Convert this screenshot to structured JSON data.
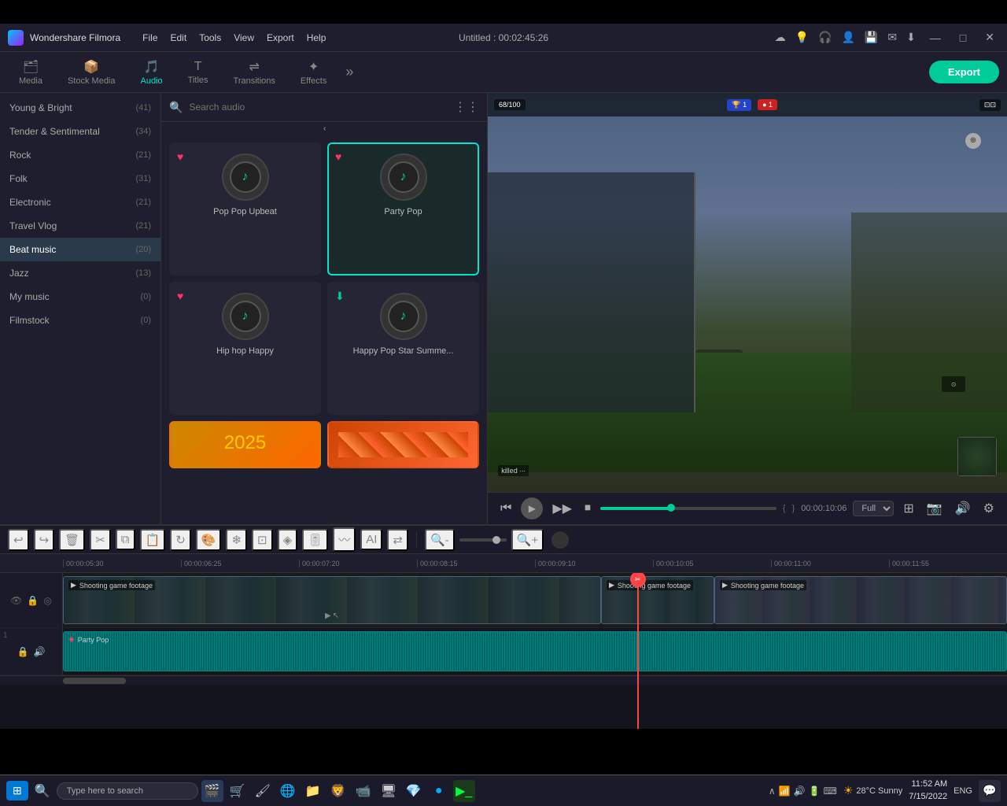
{
  "app": {
    "name": "Wondershare Filmora",
    "title": "Untitled : 00:02:45:26"
  },
  "menu": {
    "items": [
      "File",
      "Edit",
      "Tools",
      "View",
      "Export",
      "Help"
    ]
  },
  "toolbar": {
    "tabs": [
      {
        "id": "media",
        "label": "Media",
        "icon": "🗂"
      },
      {
        "id": "stock",
        "label": "Stock Media",
        "icon": "📦"
      },
      {
        "id": "audio",
        "label": "Audio",
        "icon": "♪",
        "active": true
      },
      {
        "id": "titles",
        "label": "Titles",
        "icon": "T"
      },
      {
        "id": "transitions",
        "label": "Transitions",
        "icon": "⇌"
      },
      {
        "id": "effects",
        "label": "Effects",
        "icon": "✦"
      }
    ],
    "export_label": "Export",
    "more_label": "»"
  },
  "categories": [
    {
      "name": "Young & Bright",
      "count": 41,
      "active": false
    },
    {
      "name": "Tender & Sentimental",
      "count": 34
    },
    {
      "name": "Rock",
      "count": 21
    },
    {
      "name": "Folk",
      "count": 31
    },
    {
      "name": "Electronic",
      "count": 21
    },
    {
      "name": "Travel Vlog",
      "count": 21
    },
    {
      "name": "Beat music",
      "count": 20,
      "active": true
    },
    {
      "name": "Jazz",
      "count": 13
    },
    {
      "name": "My music",
      "count": 0
    },
    {
      "name": "Filmstock",
      "count": 0
    }
  ],
  "search": {
    "placeholder": "Search audio"
  },
  "audio_items": [
    {
      "title": "Pop Pop Upbeat",
      "selected": false,
      "heart": true
    },
    {
      "title": "Party Pop",
      "selected": true,
      "heart": true
    },
    {
      "title": "Hip hop Happy",
      "selected": false,
      "heart": true
    },
    {
      "title": "Happy Pop Star Summe...",
      "selected": false,
      "heart": true
    }
  ],
  "preview": {
    "time_current": "00:00:10:06",
    "time_bracket_open": "{",
    "time_bracket_close": "}",
    "quality": "Full"
  },
  "timeline": {
    "marks": [
      "00:00:05:30",
      "00:00:06:25",
      "00:00:07:20",
      "00:00:08:15",
      "00:00:09:10",
      "00:00:10:05",
      "00:00:11:00",
      "00:00:11:55"
    ],
    "clips": [
      {
        "label": "Shooting game footage",
        "type": "video"
      },
      {
        "label": "Party Pop",
        "type": "audio"
      }
    ],
    "playhead_time": "00:00:10:05"
  },
  "taskbar": {
    "search_placeholder": "Type here to search",
    "weather": "28°C  Sunny",
    "time": "11:52 AM",
    "date": "7/15/2022",
    "language": "ENG"
  }
}
